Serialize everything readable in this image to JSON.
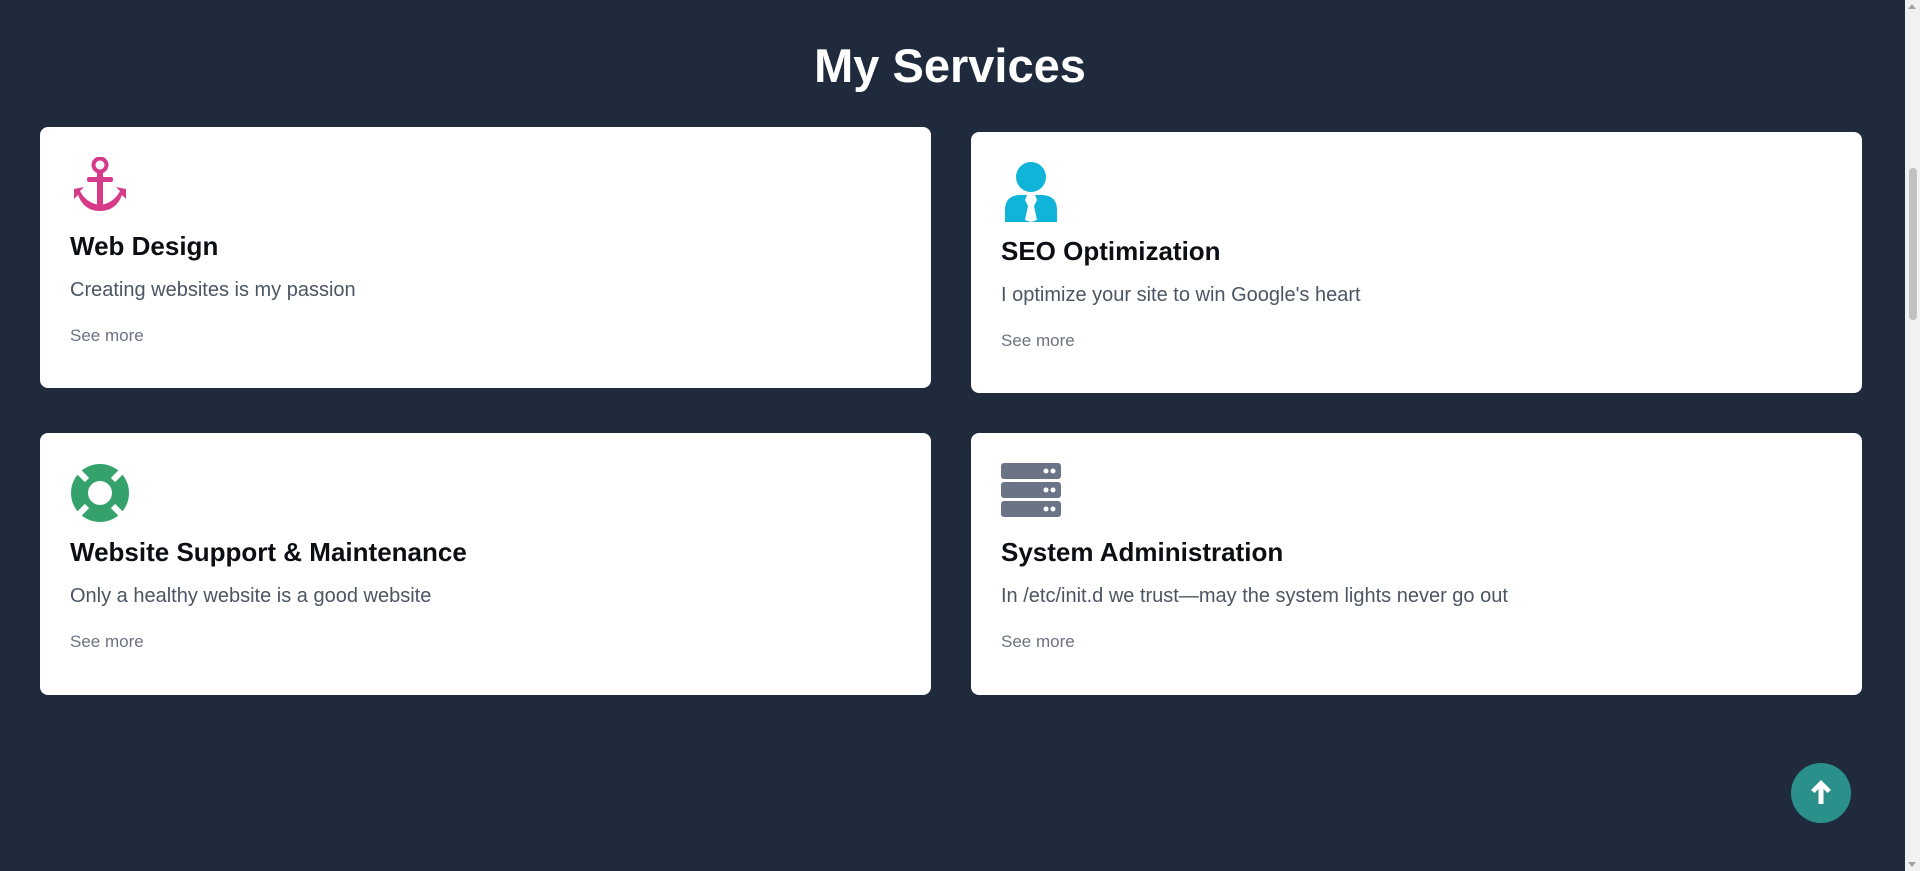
{
  "section": {
    "title": "My Services"
  },
  "services": [
    {
      "icon": "anchor-icon",
      "icon_color": "#d63b8a",
      "title": "Web Design",
      "description": "Creating websites is my passion",
      "link": "See more"
    },
    {
      "icon": "user-tie-icon",
      "icon_color": "#0fb4d8",
      "title": "SEO Optimization",
      "description": "I optimize your site to win Google's heart",
      "link": "See more"
    },
    {
      "icon": "life-ring-icon",
      "icon_color": "#36a26b",
      "title": "Website Support & Maintenance",
      "description": "Only a healthy website is a good website",
      "link": "See more"
    },
    {
      "icon": "server-icon",
      "icon_color": "#6b7487",
      "title": "System Administration",
      "description": "In /etc/init.d we trust—may the system lights never go out",
      "link": "See more"
    }
  ],
  "scroll_top": {
    "icon": "arrow-up-icon",
    "color": "#2a9089"
  }
}
